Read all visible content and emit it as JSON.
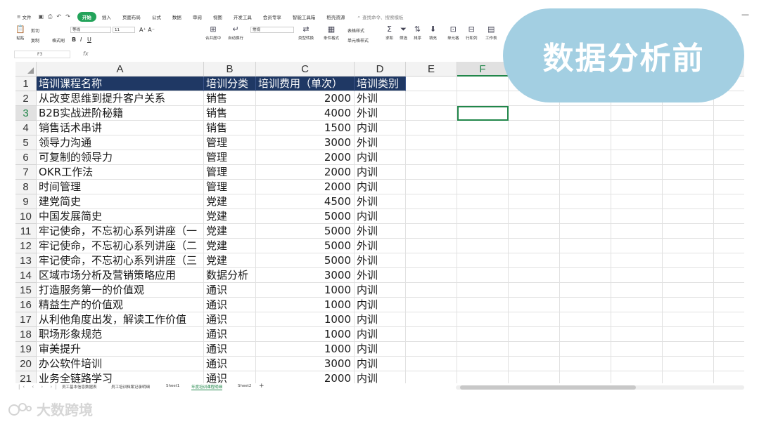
{
  "menubar": {
    "file_label": "文件",
    "tabs": [
      "开始",
      "插入",
      "页面布局",
      "公式",
      "数据",
      "审阅",
      "视图",
      "开发工具",
      "会员专享",
      "智能工具箱",
      "稻壳资源"
    ],
    "active_tab": "开始",
    "search_placeholder": "查找命令、搜索模板"
  },
  "ribbon": {
    "paste": "粘贴",
    "cut": "剪切",
    "copy": "复制",
    "format_painter": "格式刷",
    "font_name": "等线",
    "font_size": "11",
    "merge_center": "合并居中",
    "auto_wrap": "自动换行",
    "number_format": "常规",
    "type_convert": "类型转换",
    "conditional_format": "条件格式",
    "table_style": "表格样式",
    "cell_style": "单元格样式",
    "sum": "求和",
    "filter": "筛选",
    "sort": "排序",
    "fill": "填充",
    "cell": "单元格",
    "row_col": "行和列",
    "worksheet": "工作表"
  },
  "formula_bar": {
    "name_box": "F3",
    "fx": "fx"
  },
  "grid": {
    "columns": [
      "A",
      "B",
      "C",
      "D",
      "E",
      "F"
    ],
    "selected_column": "F",
    "selected_row": "3",
    "header_row": [
      "培训课程名称",
      "培训分类",
      "培训费用（单次）",
      "培训类别"
    ],
    "rows": [
      {
        "n": "2",
        "a": "从改变思维到提升客户关系",
        "b": "销售",
        "c": "2000",
        "d": "外训"
      },
      {
        "n": "3",
        "a": "B2B实战进阶秘籍",
        "b": "销售",
        "c": "4000",
        "d": "外训"
      },
      {
        "n": "4",
        "a": "销售话术串讲",
        "b": "销售",
        "c": "1500",
        "d": "内训"
      },
      {
        "n": "5",
        "a": "领导力沟通",
        "b": "管理",
        "c": "3000",
        "d": "外训"
      },
      {
        "n": "6",
        "a": "可复制的领导力",
        "b": "管理",
        "c": "2000",
        "d": "内训"
      },
      {
        "n": "7",
        "a": "OKR工作法",
        "b": "管理",
        "c": "2000",
        "d": "内训"
      },
      {
        "n": "8",
        "a": "时间管理",
        "b": "管理",
        "c": "2000",
        "d": "内训"
      },
      {
        "n": "9",
        "a": "建党简史",
        "b": "党建",
        "c": "4500",
        "d": "外训"
      },
      {
        "n": "10",
        "a": "中国发展简史",
        "b": "党建",
        "c": "5000",
        "d": "内训"
      },
      {
        "n": "11",
        "a": "牢记使命，不忘初心系列讲座（一",
        "b": "党建",
        "c": "5000",
        "d": "外训"
      },
      {
        "n": "12",
        "a": "牢记使命，不忘初心系列讲座（二",
        "b": "党建",
        "c": "5000",
        "d": "外训"
      },
      {
        "n": "13",
        "a": "牢记使命，不忘初心系列讲座（三",
        "b": "党建",
        "c": "5000",
        "d": "外训"
      },
      {
        "n": "14",
        "a": "区域市场分析及营销策略应用",
        "b": "数据分析",
        "c": "3000",
        "d": "外训"
      },
      {
        "n": "15",
        "a": "打造服务第一的价值观",
        "b": "通识",
        "c": "1000",
        "d": "内训"
      },
      {
        "n": "16",
        "a": "精益生产的价值观",
        "b": "通识",
        "c": "1000",
        "d": "内训"
      },
      {
        "n": "17",
        "a": "从利他角度出发，解读工作价值",
        "b": "通识",
        "c": "1000",
        "d": "内训"
      },
      {
        "n": "18",
        "a": "职场形象规范",
        "b": "通识",
        "c": "1000",
        "d": "内训"
      },
      {
        "n": "19",
        "a": "审美提升",
        "b": "通识",
        "c": "1000",
        "d": "内训"
      },
      {
        "n": "20",
        "a": "办公软件培训",
        "b": "通识",
        "c": "3000",
        "d": "内训"
      },
      {
        "n": "21",
        "a": "业务全链路学习",
        "b": "通识",
        "c": "2000",
        "d": "内训"
      }
    ]
  },
  "sheets": {
    "tabs": [
      "员工基本信息数据表",
      "员工培训档案记录明细",
      "Sheet1",
      "年度培训课程明细",
      "Sheet2"
    ],
    "active": "年度培训课程明细",
    "add": "+"
  },
  "overlay": {
    "title": "数据分析前"
  },
  "watermark": {
    "text": "大数跨境"
  },
  "colors": {
    "accent_green": "#21864a",
    "header_fill": "#1f3864",
    "overlay_bg": "#a3cfe2"
  }
}
